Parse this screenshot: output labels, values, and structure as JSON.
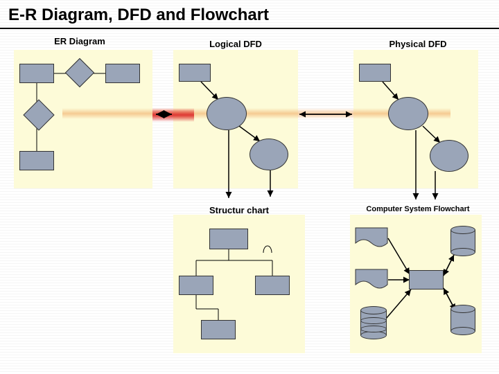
{
  "title": "E-R Diagram, DFD and Flowchart",
  "panels": {
    "er": {
      "label": "ER Diagram"
    },
    "ldfd": {
      "label": "Logical DFD"
    },
    "pdfd": {
      "label": "Physical DFD"
    },
    "struct": {
      "label": "Structur chart"
    },
    "flow": {
      "label": "Computer System Flowchart"
    }
  }
}
